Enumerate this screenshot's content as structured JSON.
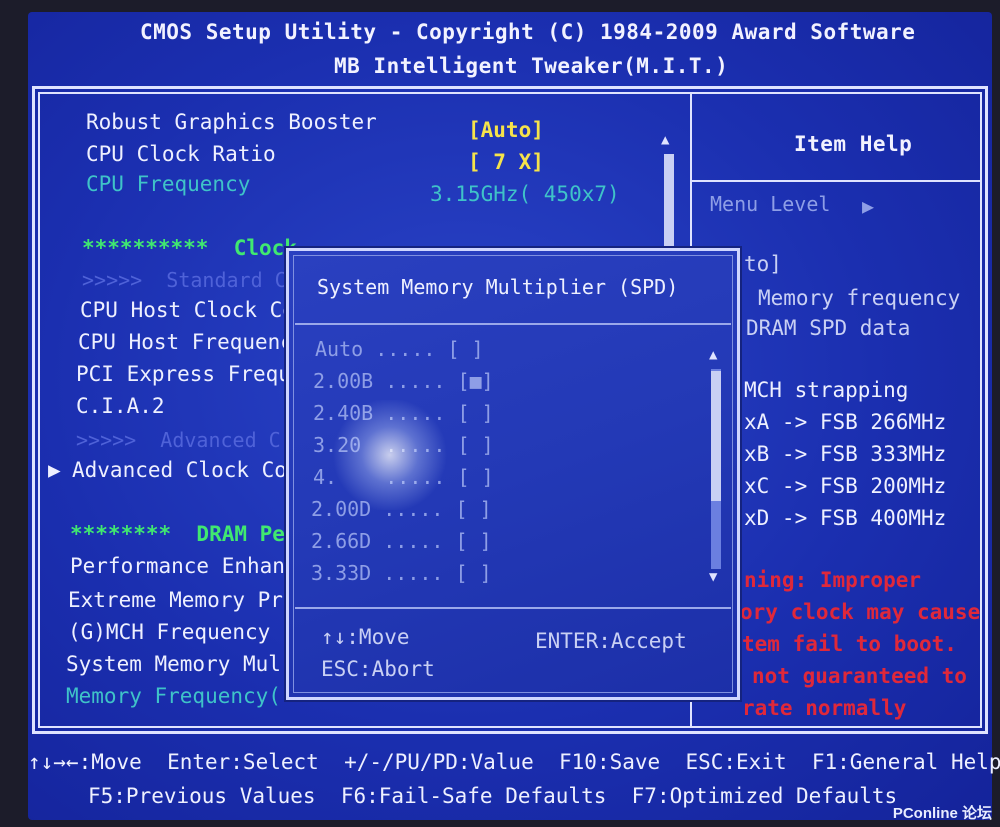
{
  "header": {
    "line1": "CMOS Setup Utility - Copyright (C) 1984-2009 Award Software",
    "line2": "MB Intelligent Tweaker(M.I.T.)"
  },
  "main": {
    "items": [
      {
        "label": "Robust Graphics Booster",
        "value": "[Auto]"
      },
      {
        "label": "CPU Clock Ratio",
        "value": "[ 7 X]"
      },
      {
        "label": "CPU Frequency",
        "value": "3.15GHz( 450x7)"
      }
    ],
    "clock_header": "**********  Clock",
    "standard_sub": ">>>>>  Standard C",
    "clock_items": [
      "CPU Host Clock Co",
      "CPU Host Frequenc",
      "PCI Express Frequ",
      "C.I.A.2"
    ],
    "advanced_sub": ">>>>>  Advanced C",
    "advanced_clock": "Advanced Clock Co",
    "dram_header": "********  DRAM Per",
    "dram_items": [
      "Performance Enhan",
      "Extreme Memory Pr",
      "(G)MCH Frequency",
      "System Memory Mul"
    ],
    "memory_freq": "Memory Frequency("
  },
  "help": {
    "title": "Item Help",
    "menu_level": "Menu Level",
    "lines": [
      "to]",
      "Memory frequency",
      "DRAM SPD data",
      "MCH strapping",
      "xA -> FSB 266MHz",
      "xB -> FSB 333MHz",
      "xC -> FSB 200MHz",
      "xD -> FSB 400MHz"
    ],
    "warning": [
      "ning: Improper",
      "ory clock may cause",
      "tem fail to boot.",
      "not guaranteed to",
      "rate normally"
    ]
  },
  "popup": {
    "title": "System Memory Multiplier (SPD)",
    "options": [
      {
        "label": "Auto",
        "mark": "[ ]"
      },
      {
        "label": "2.00B",
        "mark": "[■]"
      },
      {
        "label": "2.40B",
        "mark": "[ ]"
      },
      {
        "label": "3.20",
        "mark": "[ ]"
      },
      {
        "label": "4.",
        "mark": "[ ]"
      },
      {
        "label": "2.00D",
        "mark": "[ ]"
      },
      {
        "label": "2.66D",
        "mark": "[ ]"
      },
      {
        "label": "3.33D",
        "mark": "[ ]"
      }
    ],
    "dots": ".....",
    "move": "↑↓:Move",
    "accept": "ENTER:Accept",
    "abort": "ESC:Abort"
  },
  "footer": {
    "row1": "↑↓→←:Move  Enter:Select  +/-/PU/PD:Value  F10:Save  ESC:Exit  F1:General Help",
    "row2": "F5:Previous Values  F6:Fail-Safe Defaults  F7:Optimized Defaults"
  },
  "watermark": "PConline 论坛",
  "colors": {
    "background": "#1b2fb0",
    "highlight_value": "#f6e34a",
    "readonly": "#3fc3c8",
    "section_header": "#40e870",
    "warning": "#e0283a"
  }
}
